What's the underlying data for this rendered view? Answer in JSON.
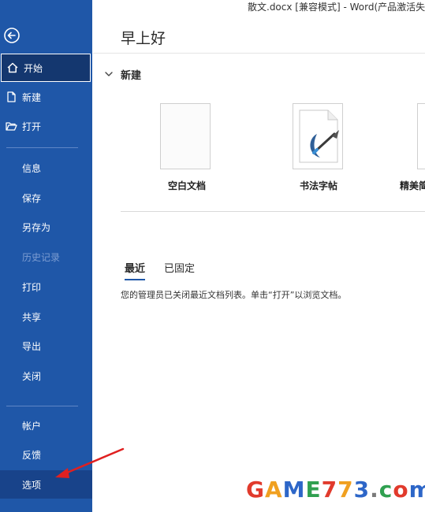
{
  "window": {
    "title": "散文.docx [兼容模式]  -  Word(产品激活失败"
  },
  "sidebar": {
    "back": "back",
    "items": [
      {
        "label": "开始",
        "icon": "home-icon"
      },
      {
        "label": "新建",
        "icon": "new-document-icon"
      },
      {
        "label": "打开",
        "icon": "open-folder-icon"
      }
    ],
    "middle": [
      {
        "label": "信息"
      },
      {
        "label": "保存"
      },
      {
        "label": "另存为"
      },
      {
        "label": "历史记录"
      },
      {
        "label": "打印"
      },
      {
        "label": "共享"
      },
      {
        "label": "导出"
      },
      {
        "label": "关闭"
      }
    ],
    "bottom": [
      {
        "label": "帐户"
      },
      {
        "label": "反馈"
      },
      {
        "label": "选项"
      }
    ]
  },
  "main": {
    "greeting": "早上好",
    "new_section": "新建",
    "templates": [
      {
        "label": "空白文档"
      },
      {
        "label": "书法字帖"
      },
      {
        "label": "精美简"
      }
    ],
    "tabs": [
      {
        "label": "最近"
      },
      {
        "label": "已固定"
      }
    ],
    "info": "您的管理员已关闭最近文档列表。单击“打开”以浏览文档。"
  },
  "watermark": {
    "text": "GAME773.com"
  },
  "colors": {
    "sidebar": "#1f57a8",
    "sidebar_active": "#14376f",
    "accent": "#1f57a8"
  }
}
